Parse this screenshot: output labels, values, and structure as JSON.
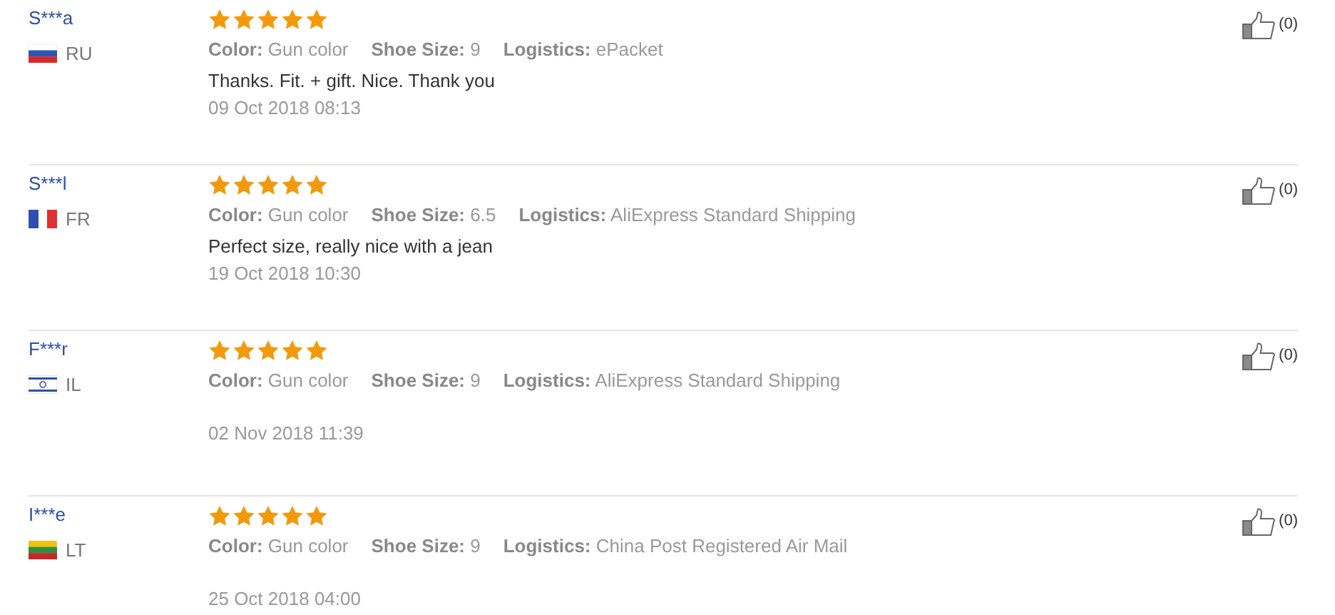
{
  "reviews": [
    {
      "user": "S***a",
      "country": "RU",
      "stars": 5,
      "color_label": "Color:",
      "product_color": "Gun color",
      "size_label": "Shoe Size:",
      "size": "9",
      "logistics_label": "Logistics:",
      "logistics": "ePacket",
      "comment": "Thanks. Fit. + gift. Nice. Thank you",
      "date": "09 Oct 2018 08:13",
      "likes": "(0)"
    },
    {
      "user": "S***l",
      "country": "FR",
      "stars": 5,
      "color_label": "Color:",
      "product_color": "Gun color",
      "size_label": "Shoe Size:",
      "size": "6.5",
      "logistics_label": "Logistics:",
      "logistics": "AliExpress Standard Shipping",
      "comment": "Perfect size, really nice with a jean",
      "date": "19 Oct 2018 10:30",
      "likes": "(0)"
    },
    {
      "user": "F***r",
      "country": "IL",
      "stars": 5,
      "color_label": "Color:",
      "product_color": "Gun color",
      "size_label": "Shoe Size:",
      "size": "9",
      "logistics_label": "Logistics:",
      "logistics": "AliExpress Standard Shipping",
      "date": "02 Nov 2018 11:39",
      "likes": "(0)"
    },
    {
      "user": "I***e",
      "country": "LT",
      "stars": 5,
      "color_label": "Color:",
      "product_color": "Gun color",
      "size_label": "Shoe Size:",
      "size": "9",
      "logistics_label": "Logistics:",
      "logistics": "China Post Registered Air Mail",
      "date": "25 Oct 2018 04:00",
      "likes": "(0)"
    }
  ]
}
